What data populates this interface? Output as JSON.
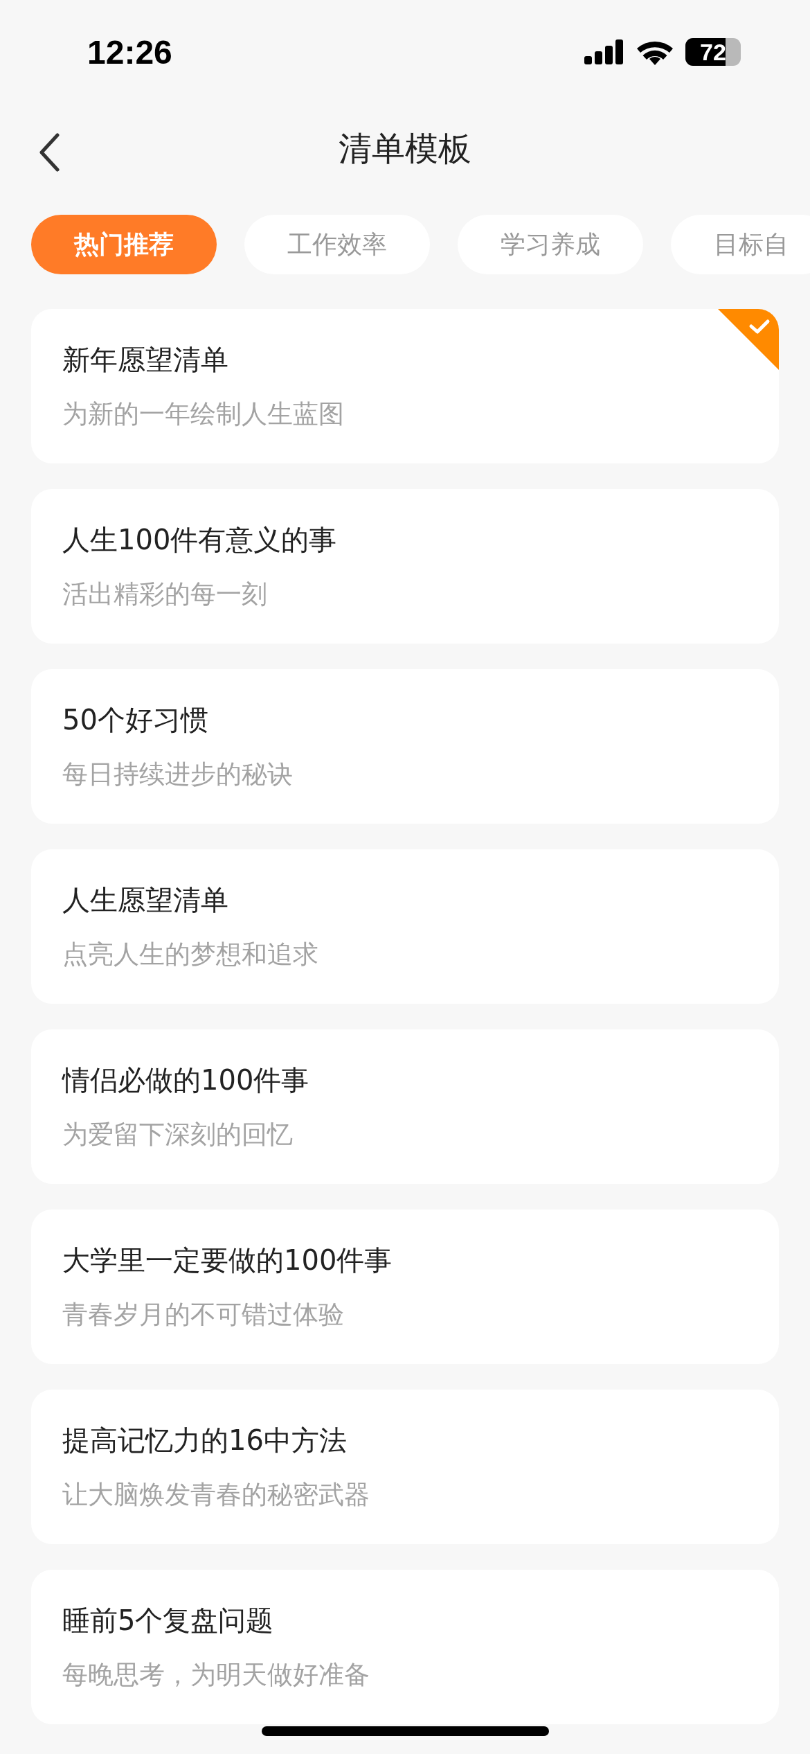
{
  "status_bar": {
    "time": "12:26",
    "battery": "72"
  },
  "nav": {
    "title": "清单模板"
  },
  "tabs": [
    {
      "label": "热门推荐",
      "selected": true
    },
    {
      "label": "工作效率",
      "selected": false
    },
    {
      "label": "学习养成",
      "selected": false
    },
    {
      "label": "目标自",
      "selected": false
    }
  ],
  "templates": [
    {
      "title": "新年愿望清单",
      "subtitle": "为新的一年绘制人生蓝图",
      "selected": true
    },
    {
      "title": "人生100件有意义的事",
      "subtitle": "活出精彩的每一刻",
      "selected": false
    },
    {
      "title": "50个好习惯",
      "subtitle": "每日持续进步的秘诀",
      "selected": false
    },
    {
      "title": "人生愿望清单",
      "subtitle": "点亮人生的梦想和追求",
      "selected": false
    },
    {
      "title": "情侣必做的100件事",
      "subtitle": "为爱留下深刻的回忆",
      "selected": false
    },
    {
      "title": "大学里一定要做的100件事",
      "subtitle": "青春岁月的不可错过体验",
      "selected": false
    },
    {
      "title": "提高记忆力的16中方法",
      "subtitle": "让大脑焕发青春的秘密武器",
      "selected": false
    },
    {
      "title": "睡前5个复盘问题",
      "subtitle": "每晚思考，为明天做好准备",
      "selected": false
    }
  ]
}
